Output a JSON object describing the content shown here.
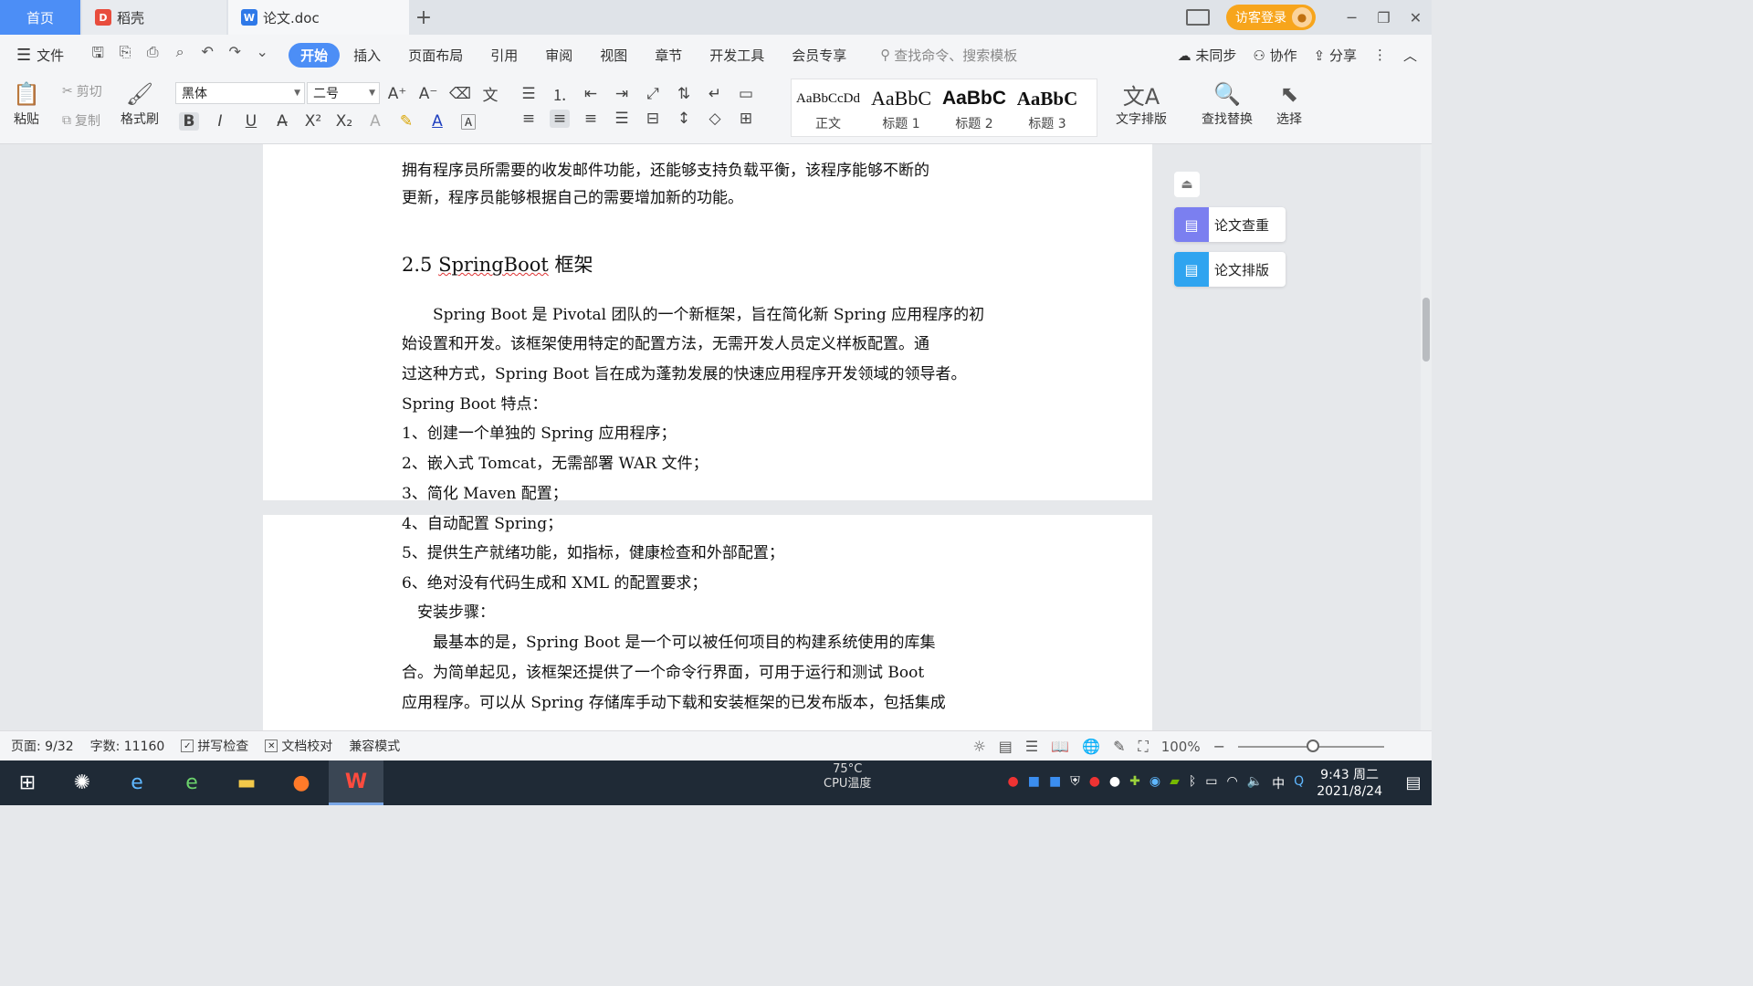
{
  "tabs": {
    "home": "首页",
    "daoke": "稻壳",
    "doc": "论文.doc",
    "login": "访客登录"
  },
  "menu": {
    "file": "文件",
    "items": [
      "开始",
      "插入",
      "页面布局",
      "引用",
      "审阅",
      "视图",
      "章节",
      "开发工具",
      "会员专享"
    ],
    "search_placeholder": "查找命令、搜索模板",
    "sync": "未同步",
    "collab": "协作",
    "share": "分享"
  },
  "ribbon": {
    "paste": "粘贴",
    "cut": "剪切",
    "copy": "复制",
    "format_painter": "格式刷",
    "font_name": "黑体",
    "font_size": "二号",
    "styles": [
      {
        "sample": "AaBbCcDd",
        "name": "正文"
      },
      {
        "sample": "AaBbC",
        "name": "标题 1"
      },
      {
        "sample": "AaBbC",
        "name": "标题 2"
      },
      {
        "sample": "AaBbC",
        "name": "标题 3"
      }
    ],
    "text_layout": "文字排版",
    "find_replace": "查找替换",
    "select": "选择"
  },
  "document": {
    "lines_top": [
      "拥有程序员所需要的收发邮件功能，还能够支持负载平衡，该程序能够不断的",
      "更新，程序员能够根据自己的需要增加新的功能。"
    ],
    "heading_num": "2.5",
    "heading_sb": "SpringBoot",
    "heading_rest": "框架",
    "body_lines": [
      "　　Spring Boot 是 Pivotal 团队的一个新框架，旨在简化新 Spring 应用程序的初",
      "始设置和开发。该框架使用特定的配置方法，无需开发人员定义样板配置。通",
      "过这种方式，Spring Boot 旨在成为蓬勃发展的快速应用程序开发领域的领导者。",
      "Spring Boot 特点：",
      "1、创建一个单独的 Spring 应用程序；",
      "2、嵌入式 Tomcat，无需部署 WAR 文件；",
      "3、简化 Maven 配置；"
    ],
    "page2_lines": [
      "4、自动配置 Spring；",
      "5、提供生产就绪功能，如指标，健康检查和外部配置；",
      "6、绝对没有代码生成和 XML 的配置要求；",
      "　安装步骤：",
      "　　最基本的是，Spring Boot 是一个可以被任何项目的构建系统使用的库集",
      "合。为简单起见，该框架还提供了一个命令行界面，可用于运行和测试 Boot",
      "应用程序。可以从 Spring 存储库手动下载和安装框架的已发布版本，包括集成"
    ]
  },
  "side_panel": {
    "check": "论文查重",
    "layout": "论文排版"
  },
  "status": {
    "page": "页面: 9/32",
    "words": "字数: 11160",
    "spell": "拼写检查",
    "proof": "文档校对",
    "compat": "兼容模式",
    "zoom": "100%"
  },
  "taskbar": {
    "cpu_temp": "75°C",
    "cpu_label": "CPU温度",
    "ime": "中",
    "time": "9:43 周二",
    "date": "2021/8/24"
  },
  "colors": {
    "accent": "#4c8ef6",
    "login": "#f7a51c",
    "side_check": "#7b7ff0",
    "side_layout": "#2fa4f0"
  }
}
